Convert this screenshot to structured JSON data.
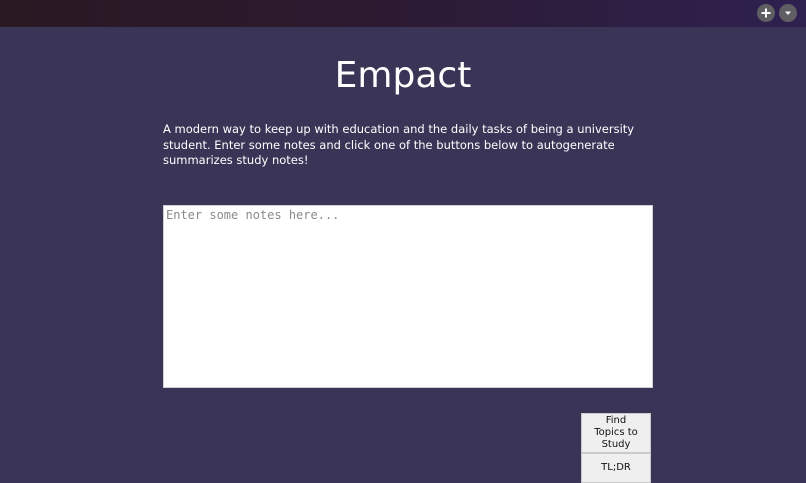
{
  "header": {
    "buttons": [
      {
        "icon": "plus-icon"
      },
      {
        "icon": "chevron-down-icon"
      }
    ]
  },
  "main": {
    "title": "Empact",
    "description": "A modern way to keep up with education and the daily tasks of being a university student. Enter some notes and click one of the buttons below to autogenerate summarizes study notes!",
    "notes_input": {
      "value": "",
      "placeholder": "Enter some notes here..."
    },
    "actions": {
      "find_topics_label": "Find Topics to Study",
      "tldr_label": "TL;DR"
    }
  },
  "colors": {
    "background": "#3a3557",
    "text": "#ffffff",
    "topbar_start": "#2a1822",
    "topbar_end": "#2e2150"
  }
}
